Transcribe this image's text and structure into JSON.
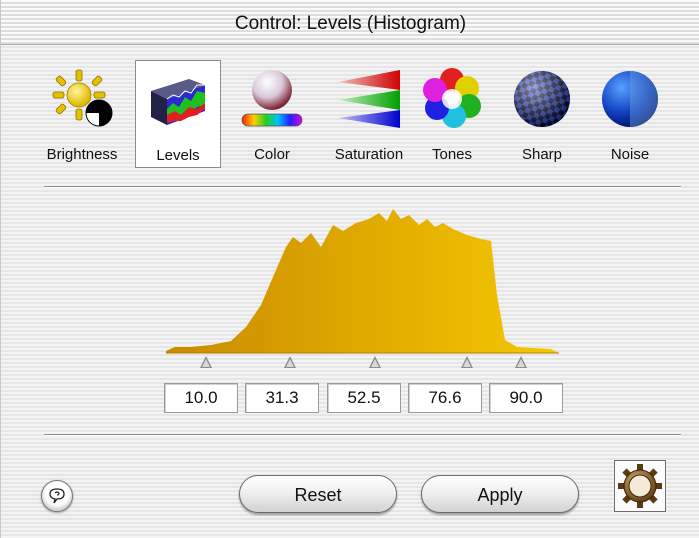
{
  "window": {
    "title": "Control: Levels (Histogram)"
  },
  "toolbar": {
    "items": [
      {
        "label": "Brightness",
        "icon": "brightness-sun-icon",
        "selected": false
      },
      {
        "label": "Levels",
        "icon": "levels-histogram-icon",
        "selected": true
      },
      {
        "label": "Color",
        "icon": "color-sphere-icon",
        "selected": false
      },
      {
        "label": "Saturation",
        "icon": "saturation-cones-icon",
        "selected": false
      },
      {
        "label": "Tones",
        "icon": "tones-balls-icon",
        "selected": false
      },
      {
        "label": "Sharp",
        "icon": "sharp-checker-sphere-icon",
        "selected": false
      },
      {
        "label": "Noise",
        "icon": "noise-sphere-icon",
        "selected": false
      }
    ]
  },
  "levels": {
    "values": [
      "10.0",
      "31.3",
      "52.5",
      "76.6",
      "90.0"
    ],
    "histogram_color_start": "#c98a00",
    "histogram_color_end": "#f5c800"
  },
  "buttons": {
    "help_icon": "help-balloon-icon",
    "reset_label": "Reset",
    "apply_label": "Apply",
    "gear_icon": "gear-compass-icon"
  }
}
